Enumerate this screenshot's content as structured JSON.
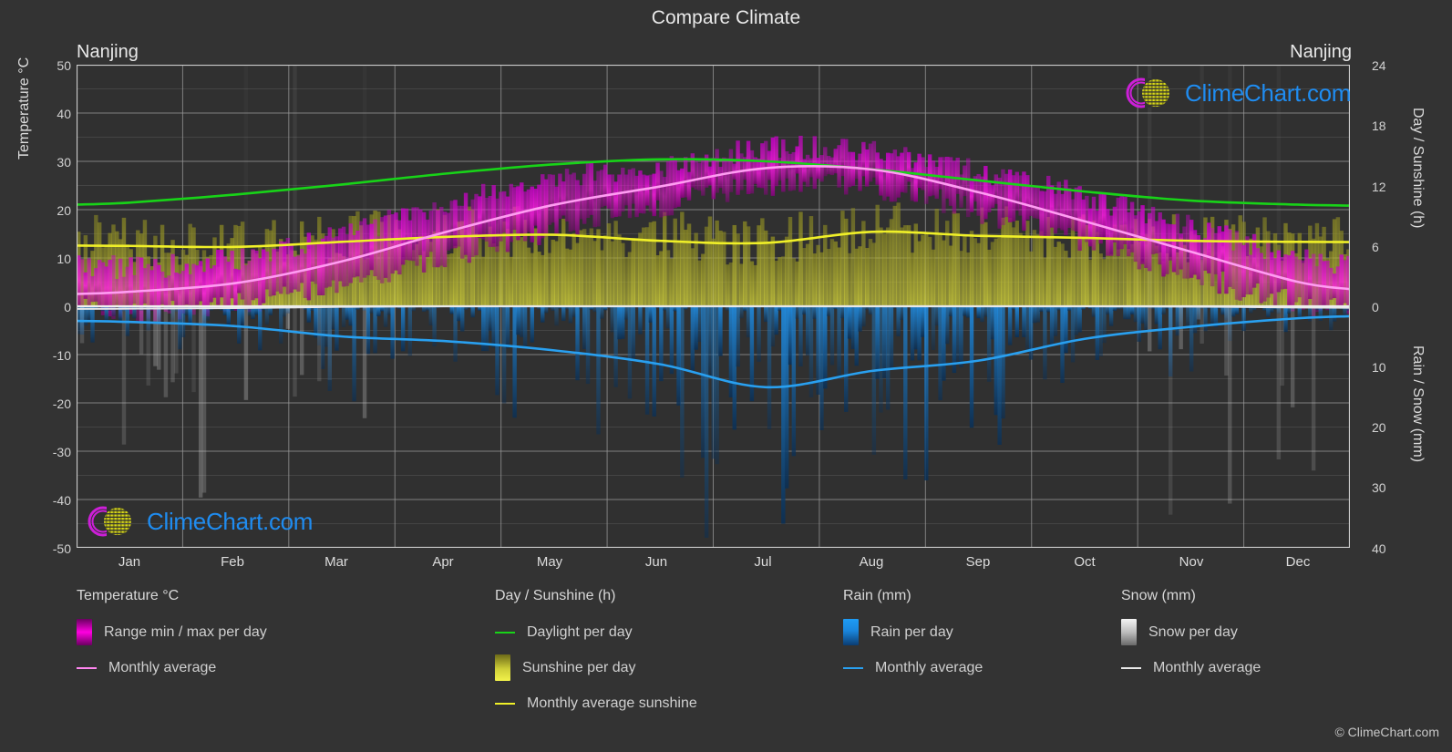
{
  "header": {
    "title": "Compare Climate",
    "city_left": "Nanjing",
    "city_right": "Nanjing"
  },
  "axes": {
    "left_label": "Temperature °C",
    "right_top_label": "Day / Sunshine (h)",
    "right_bottom_label": "Rain / Snow (mm)",
    "left_ticks": [
      "50",
      "40",
      "30",
      "20",
      "10",
      "0",
      "-10",
      "-20",
      "-30",
      "-40",
      "-50"
    ],
    "right_top_ticks": [
      "24",
      "18",
      "12",
      "6",
      "0"
    ],
    "right_bottom_ticks": [
      "0",
      "10",
      "20",
      "30",
      "40"
    ],
    "months": [
      "Jan",
      "Feb",
      "Mar",
      "Apr",
      "May",
      "Jun",
      "Jul",
      "Aug",
      "Sep",
      "Oct",
      "Nov",
      "Dec"
    ]
  },
  "legend": {
    "groups": [
      {
        "title": "Temperature °C",
        "items": [
          {
            "label": "Range min / max per day",
            "style": "gradient",
            "color": "#ff00e0",
            "color2": "#6a0060"
          },
          {
            "label": "Monthly average",
            "style": "line",
            "color": "#ff86f0"
          }
        ]
      },
      {
        "title": "Day / Sunshine (h)",
        "items": [
          {
            "label": "Daylight per day",
            "style": "line",
            "color": "#18d318"
          },
          {
            "label": "Sunshine per day",
            "style": "gradient",
            "color": "#f2f24a",
            "color2": "#6d6a18"
          },
          {
            "label": "Monthly average sunshine",
            "style": "line",
            "color": "#f0f028"
          }
        ]
      },
      {
        "title": "Rain (mm)",
        "items": [
          {
            "label": "Rain per day",
            "style": "gradient",
            "color": "#1e9cf5",
            "color2": "#0b3d72"
          },
          {
            "label": "Monthly average",
            "style": "line",
            "color": "#29a0f0"
          }
        ]
      },
      {
        "title": "Snow (mm)",
        "items": [
          {
            "label": "Snow per day",
            "style": "gradient",
            "color": "#f4f4f4",
            "color2": "#6a6a6a"
          },
          {
            "label": "Monthly average",
            "style": "line",
            "color": "#e8e8e8"
          }
        ]
      }
    ]
  },
  "watermark": {
    "text": "ClimeChart.com",
    "copyright": "© ClimeChart.com"
  },
  "colors": {
    "background": "#333333",
    "plot_background": "#303030",
    "grid": "#8a8a8a",
    "text": "#dcdcdc",
    "temp_range": "#ff00e0",
    "temp_avg": "#ff86f0",
    "daylight": "#18d318",
    "sunshine": "#f0f028",
    "rain": "#1e9cf5",
    "snow": "#e8e8e8",
    "logo_blue": "#1f8cf0",
    "logo_magenta": "#d41fd4",
    "logo_yellow": "#d8d818"
  },
  "chart_data": {
    "type": "area",
    "title": "Compare Climate",
    "subtitle": "Nanjing",
    "xlabel": "",
    "ylabel": "Temperature °C",
    "categories": [
      "Jan",
      "Feb",
      "Mar",
      "Apr",
      "May",
      "Jun",
      "Jul",
      "Aug",
      "Sep",
      "Oct",
      "Nov",
      "Dec"
    ],
    "axis_ranges": {
      "temperature_c": [
        -50,
        50
      ],
      "day_sunshine_h": [
        0,
        24
      ],
      "rain_snow_mm": [
        0,
        40
      ]
    },
    "grid": true,
    "legend_position": "bottom",
    "series": [
      {
        "name": "Monthly average temperature (°C)",
        "unit": "°C",
        "color": "#ff86f0",
        "values": [
          3.0,
          4.8,
          9.3,
          15.5,
          21.0,
          24.8,
          28.6,
          28.3,
          23.6,
          17.6,
          11.3,
          5.1
        ]
      },
      {
        "name": "Daily max temperature range top (°C)",
        "unit": "°C",
        "color": "#ff00e0",
        "values": [
          8.0,
          10.0,
          14.8,
          21.2,
          26.4,
          29.2,
          32.6,
          32.3,
          28.0,
          22.6,
          16.4,
          10.2
        ]
      },
      {
        "name": "Daily min temperature range bottom (°C)",
        "unit": "°C",
        "color": "#6a0060",
        "values": [
          -1.0,
          0.8,
          4.5,
          10.2,
          16.0,
          20.8,
          24.8,
          24.5,
          19.6,
          13.2,
          6.6,
          0.6
        ]
      },
      {
        "name": "Daylight per day (h)",
        "unit": "h",
        "color": "#18d318",
        "values": [
          10.3,
          11.1,
          12.1,
          13.2,
          14.1,
          14.6,
          14.4,
          13.6,
          12.5,
          11.4,
          10.5,
          10.1
        ]
      },
      {
        "name": "Monthly average sunshine (h)",
        "unit": "h",
        "color": "#f0f028",
        "values": [
          6.0,
          5.9,
          6.4,
          6.9,
          7.1,
          6.5,
          6.3,
          7.4,
          7.0,
          6.8,
          6.5,
          6.4
        ]
      },
      {
        "name": "Monthly average rain (mm)",
        "unit": "mm",
        "color": "#29a0f0",
        "values": [
          2.6,
          3.3,
          5.0,
          5.8,
          7.3,
          9.6,
          13.4,
          10.7,
          9.0,
          5.4,
          3.4,
          2.0
        ]
      },
      {
        "name": "Monthly average snow (mm)",
        "unit": "mm",
        "color": "#e8e8e8",
        "values": [
          0.4,
          0.3,
          0.1,
          0.0,
          0.0,
          0.0,
          0.0,
          0.0,
          0.0,
          0.0,
          0.05,
          0.2
        ]
      }
    ]
  }
}
